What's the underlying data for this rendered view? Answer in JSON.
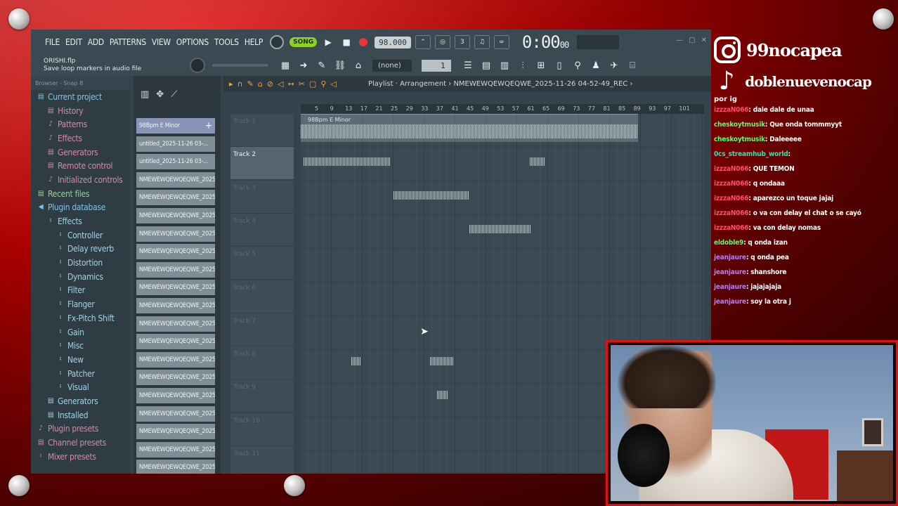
{
  "fl": {
    "menu": [
      "FILE",
      "EDIT",
      "ADD",
      "PATTERNS",
      "VIEW",
      "OPTIONS",
      "TOOLS",
      "HELP"
    ],
    "song_label": "SONG",
    "tempo": "98.000",
    "time": "0:00",
    "time_small": "00",
    "hint_file": "ORISHI.flp",
    "hint_text": "Save loop markers in audio file",
    "pattern_selector": "(none)",
    "pattern_num": "1"
  },
  "browser": {
    "header": "Browser - Snap 8",
    "items": [
      {
        "label": "Current project",
        "icon": "▤",
        "color": "c-blue",
        "indent": 0
      },
      {
        "label": "History",
        "icon": "▤",
        "color": "c-pink",
        "indent": 1
      },
      {
        "label": "Patterns",
        "icon": "♪",
        "color": "c-pink",
        "indent": 1
      },
      {
        "label": "Effects",
        "icon": "♪",
        "color": "c-pink",
        "indent": 1
      },
      {
        "label": "Generators",
        "icon": "▤",
        "color": "c-pink",
        "indent": 1
      },
      {
        "label": "Remote control",
        "icon": "▤",
        "color": "c-pink",
        "indent": 1
      },
      {
        "label": "Initialized controls",
        "icon": "♪",
        "color": "c-pink",
        "indent": 1
      },
      {
        "label": "Recent files",
        "icon": "▤",
        "color": "c-green",
        "indent": 0
      },
      {
        "label": "Plugin database",
        "icon": "◀",
        "color": "c-blue",
        "indent": 0
      },
      {
        "label": "Effects",
        "icon": "♮",
        "color": "c-teal",
        "indent": 1
      },
      {
        "label": "Controller",
        "icon": "♮",
        "color": "c-teal",
        "indent": 2
      },
      {
        "label": "Delay reverb",
        "icon": "♮",
        "color": "c-teal",
        "indent": 2
      },
      {
        "label": "Distortion",
        "icon": "♮",
        "color": "c-teal",
        "indent": 2
      },
      {
        "label": "Dynamics",
        "icon": "♮",
        "color": "c-teal",
        "indent": 2
      },
      {
        "label": "Filter",
        "icon": "♮",
        "color": "c-teal",
        "indent": 2
      },
      {
        "label": "Flanger",
        "icon": "♮",
        "color": "c-teal",
        "indent": 2
      },
      {
        "label": "Fx-Pitch Shift",
        "icon": "♮",
        "color": "c-teal",
        "indent": 2
      },
      {
        "label": "Gain",
        "icon": "♮",
        "color": "c-teal",
        "indent": 2
      },
      {
        "label": "Misc",
        "icon": "♮",
        "color": "c-teal",
        "indent": 2
      },
      {
        "label": "New",
        "icon": "♮",
        "color": "c-teal",
        "indent": 2
      },
      {
        "label": "Patcher",
        "icon": "♮",
        "color": "c-teal",
        "indent": 2
      },
      {
        "label": "Visual",
        "icon": "♮",
        "color": "c-teal",
        "indent": 2
      },
      {
        "label": "Generators",
        "icon": "▤",
        "color": "c-teal",
        "indent": 1
      },
      {
        "label": "Installed",
        "icon": "▤",
        "color": "c-teal",
        "indent": 1
      },
      {
        "label": "Plugin presets",
        "icon": "♪",
        "color": "c-pink",
        "indent": 0
      },
      {
        "label": "Channel presets",
        "icon": "▤",
        "color": "c-pink",
        "indent": 0
      },
      {
        "label": "Mixer presets",
        "icon": "♮",
        "color": "c-pink",
        "indent": 0
      }
    ]
  },
  "channels": [
    "98Bpm E Minor",
    "untitled_2025-11-26 03-...",
    "untitled_2025-11-26 03-...",
    "NMEWEWQEWQEQWE_2025...",
    "NMEWEWQEWQEQWE_2025...",
    "NMEWEWQEWQEQWE_2025...",
    "NMEWEWQEWQEQWE_2025...",
    "NMEWEWQEWQEQWE_2025...",
    "NMEWEWQEWQEQWE_2025...",
    "NMEWEWQEWQEQWE_2025...",
    "NMEWEWQEWQEQWE_2025...",
    "NMEWEWQEWQEQWE_2025...",
    "NMEWEWQEWQEQWE_2025...",
    "NMEWEWQEWQEQWE_2025...",
    "NMEWEWQEWQEQWE_2025...",
    "NMEWEWQEWQEQWE_2025...",
    "NMEWEWQEWQEQWE_2025...",
    "NMEWEWQEWQEQWE_2025...",
    "NMEWEWQEWQEQWE_2025...",
    "NMEWEWQEWQEQWE_2025..."
  ],
  "playlist": {
    "title": "Playlist · Arrangement › NMEWEWQEWQEQWE_2025-11-26 04-52-49_REC ›",
    "ruler": [
      "5",
      "9",
      "13",
      "17",
      "21",
      "25",
      "29",
      "33",
      "37",
      "41",
      "45",
      "49",
      "53",
      "57",
      "61",
      "65",
      "69",
      "73",
      "77",
      "81",
      "85",
      "89",
      "93",
      "97",
      "101"
    ],
    "tracks": [
      "Track 1",
      "Track 2",
      "Track 3",
      "Track 4",
      "Track 5",
      "Track 6",
      "Track 7",
      "Track 8",
      "Track 9",
      "Track 10",
      "Track 11"
    ],
    "selected_track": "Track 2",
    "clip_label": "98Bpm E Minor"
  },
  "social": {
    "instagram": "99nocapea",
    "tiktok": "doblenuevenocap",
    "note": "por ig"
  },
  "chat": [
    {
      "user": "izzzaN066",
      "color": "#ff4d6d",
      "text": ": dale dale de unaa"
    },
    {
      "user": "cheskoytmusik",
      "color": "#5dff6a",
      "text": ": Que onda tommmyyt"
    },
    {
      "user": "cheskoytmusik",
      "color": "#5dff6a",
      "text": ": Daleeeee"
    },
    {
      "user": "0cs_streamhub_world",
      "color": "#2ce6b8",
      "text": ":"
    },
    {
      "user": "izzzaN066",
      "color": "#ff4d6d",
      "text": ": QUE TEMON"
    },
    {
      "user": "izzzaN066",
      "color": "#ff4d6d",
      "text": ": q ondaaa"
    },
    {
      "user": "izzzaN066",
      "color": "#ff4d6d",
      "text": ": aparezco un toque jajaj"
    },
    {
      "user": "izzzaN066",
      "color": "#ff4d6d",
      "text": ": o va con delay el chat o se cayó"
    },
    {
      "user": "izzzaN066",
      "color": "#ff4d6d",
      "text": ": va con delay nomas"
    },
    {
      "user": "eldoble9",
      "color": "#5dff6a",
      "text": ": q onda izan"
    },
    {
      "user": "jeanjaure",
      "color": "#b77dff",
      "text": ": q onda pea"
    },
    {
      "user": "jeanjaure",
      "color": "#b77dff",
      "text": ": shanshore"
    },
    {
      "user": "jeanjaure",
      "color": "#b77dff",
      "text": ": jajajajaja"
    },
    {
      "user": "jeanjaure",
      "color": "#b77dff",
      "text": ": soy la otra j"
    }
  ]
}
